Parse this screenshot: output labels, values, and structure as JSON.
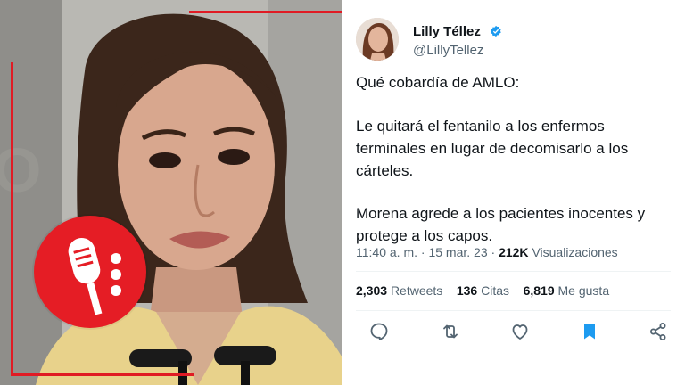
{
  "tweet": {
    "display_name": "Lilly Téllez",
    "handle": "@LillyTellez",
    "text_line1": "Qué cobardía de AMLO:",
    "paragraph2_line1": "Le quitará el fentanilo a los enfermos",
    "paragraph2_line2": "terminales en lugar de decomisarlo a los",
    "paragraph2_line3": "cárteles.",
    "paragraph3_line1": "Morena agrede a los pacientes inocentes y",
    "paragraph3_line2": "protege a los capos.",
    "time": "11:40 a. m.",
    "separator": "·",
    "date": "15 mar. 23",
    "views_count": "212K",
    "views_label": "Visualizaciones",
    "retweets_count": "2,303",
    "retweets_label": "Retweets",
    "quotes_count": "136",
    "quotes_label": "Citas",
    "likes_count": "6,819",
    "likes_label": "Me gusta"
  },
  "icons": {
    "verified": "verified-badge-icon",
    "reply": "reply-icon",
    "retweet": "retweet-icon",
    "like": "heart-icon",
    "bookmark": "bookmark-icon",
    "share": "share-icon",
    "badge": "microphone-icon"
  },
  "colors": {
    "frame_red": "#e01b24",
    "badge_red": "#e51d25",
    "twitter_blue": "#1d9bf0",
    "text_primary": "#0f1419",
    "text_secondary": "#536471"
  }
}
